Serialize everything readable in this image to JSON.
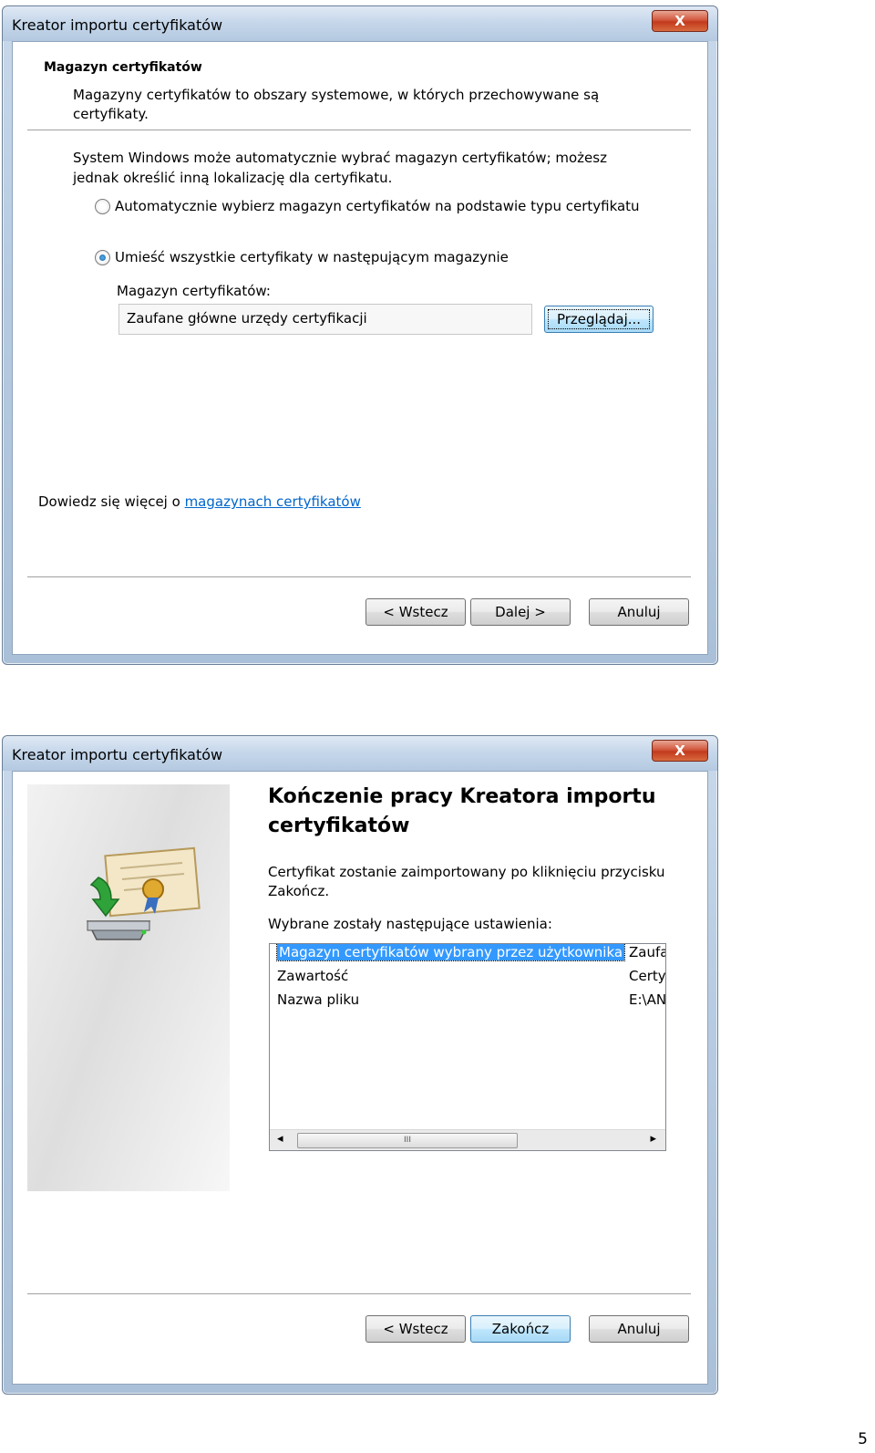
{
  "dialog1": {
    "title": "Kreator importu certyfikatów",
    "close_label": "X",
    "heading": "Magazyn certyfikatów",
    "subheading": "Magazyny certyfikatów to obszary systemowe, w których przechowywane są certyfikaty.",
    "intro": "System Windows może automatycznie wybrać magazyn certyfikatów; możesz jednak określić inną lokalizację dla certyfikatu.",
    "radio_auto": "Automatycznie wybierz magazyn certyfikatów na podstawie typu certyfikatu",
    "radio_manual": "Umieść wszystkie certyfikaty w następującym magazynie",
    "store_label": "Magazyn certyfikatów:",
    "store_value": "Zaufane główne urzędy certyfikacji",
    "browse_button": "Przeglądaj...",
    "learn_more_prefix": "Dowiedz się więcej o ",
    "learn_more_link": "magazynach certyfikatów",
    "back_button": "< Wstecz",
    "next_button": "Dalej >",
    "cancel_button": "Anuluj"
  },
  "dialog2": {
    "title": "Kreator importu certyfikatów",
    "close_label": "X",
    "heading": "Kończenie pracy Kreatora importu certyfikatów",
    "description": "Certyfikat zostanie zaimportowany po kliknięciu przycisku Zakończ.",
    "settings_label": "Wybrane zostały następujące ustawienia:",
    "settings_rows": [
      {
        "name": "Magazyn certyfikatów wybrany przez użytkownika",
        "value": "Zaufa"
      },
      {
        "name": "Zawartość",
        "value": "Certy"
      },
      {
        "name": "Nazwa pliku",
        "value": "E:\\AN"
      }
    ],
    "scroll_left": "◂",
    "scroll_right": "▸",
    "scroll_grip": "III",
    "back_button": "< Wstecz",
    "finish_button": "Zakończ",
    "cancel_button": "Anuluj"
  },
  "page_number": "5"
}
